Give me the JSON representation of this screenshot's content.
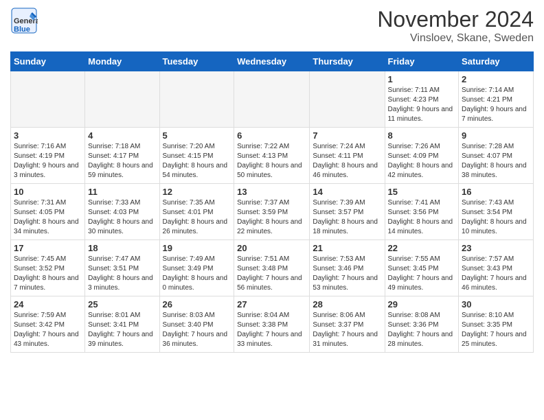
{
  "logo": {
    "line1": "General",
    "line2": "Blue"
  },
  "title": "November 2024",
  "location": "Vinsloev, Skane, Sweden",
  "days_of_week": [
    "Sunday",
    "Monday",
    "Tuesday",
    "Wednesday",
    "Thursday",
    "Friday",
    "Saturday"
  ],
  "weeks": [
    [
      {
        "day": "",
        "empty": true
      },
      {
        "day": "",
        "empty": true
      },
      {
        "day": "",
        "empty": true
      },
      {
        "day": "",
        "empty": true
      },
      {
        "day": "",
        "empty": true
      },
      {
        "day": "1",
        "sunrise": "7:11 AM",
        "sunset": "4:23 PM",
        "daylight": "9 hours and 11 minutes."
      },
      {
        "day": "2",
        "sunrise": "7:14 AM",
        "sunset": "4:21 PM",
        "daylight": "9 hours and 7 minutes."
      }
    ],
    [
      {
        "day": "3",
        "sunrise": "7:16 AM",
        "sunset": "4:19 PM",
        "daylight": "9 hours and 3 minutes."
      },
      {
        "day": "4",
        "sunrise": "7:18 AM",
        "sunset": "4:17 PM",
        "daylight": "8 hours and 59 minutes."
      },
      {
        "day": "5",
        "sunrise": "7:20 AM",
        "sunset": "4:15 PM",
        "daylight": "8 hours and 54 minutes."
      },
      {
        "day": "6",
        "sunrise": "7:22 AM",
        "sunset": "4:13 PM",
        "daylight": "8 hours and 50 minutes."
      },
      {
        "day": "7",
        "sunrise": "7:24 AM",
        "sunset": "4:11 PM",
        "daylight": "8 hours and 46 minutes."
      },
      {
        "day": "8",
        "sunrise": "7:26 AM",
        "sunset": "4:09 PM",
        "daylight": "8 hours and 42 minutes."
      },
      {
        "day": "9",
        "sunrise": "7:28 AM",
        "sunset": "4:07 PM",
        "daylight": "8 hours and 38 minutes."
      }
    ],
    [
      {
        "day": "10",
        "sunrise": "7:31 AM",
        "sunset": "4:05 PM",
        "daylight": "8 hours and 34 minutes."
      },
      {
        "day": "11",
        "sunrise": "7:33 AM",
        "sunset": "4:03 PM",
        "daylight": "8 hours and 30 minutes."
      },
      {
        "day": "12",
        "sunrise": "7:35 AM",
        "sunset": "4:01 PM",
        "daylight": "8 hours and 26 minutes."
      },
      {
        "day": "13",
        "sunrise": "7:37 AM",
        "sunset": "3:59 PM",
        "daylight": "8 hours and 22 minutes."
      },
      {
        "day": "14",
        "sunrise": "7:39 AM",
        "sunset": "3:57 PM",
        "daylight": "8 hours and 18 minutes."
      },
      {
        "day": "15",
        "sunrise": "7:41 AM",
        "sunset": "3:56 PM",
        "daylight": "8 hours and 14 minutes."
      },
      {
        "day": "16",
        "sunrise": "7:43 AM",
        "sunset": "3:54 PM",
        "daylight": "8 hours and 10 minutes."
      }
    ],
    [
      {
        "day": "17",
        "sunrise": "7:45 AM",
        "sunset": "3:52 PM",
        "daylight": "8 hours and 7 minutes."
      },
      {
        "day": "18",
        "sunrise": "7:47 AM",
        "sunset": "3:51 PM",
        "daylight": "8 hours and 3 minutes."
      },
      {
        "day": "19",
        "sunrise": "7:49 AM",
        "sunset": "3:49 PM",
        "daylight": "8 hours and 0 minutes."
      },
      {
        "day": "20",
        "sunrise": "7:51 AM",
        "sunset": "3:48 PM",
        "daylight": "7 hours and 56 minutes."
      },
      {
        "day": "21",
        "sunrise": "7:53 AM",
        "sunset": "3:46 PM",
        "daylight": "7 hours and 53 minutes."
      },
      {
        "day": "22",
        "sunrise": "7:55 AM",
        "sunset": "3:45 PM",
        "daylight": "7 hours and 49 minutes."
      },
      {
        "day": "23",
        "sunrise": "7:57 AM",
        "sunset": "3:43 PM",
        "daylight": "7 hours and 46 minutes."
      }
    ],
    [
      {
        "day": "24",
        "sunrise": "7:59 AM",
        "sunset": "3:42 PM",
        "daylight": "7 hours and 43 minutes."
      },
      {
        "day": "25",
        "sunrise": "8:01 AM",
        "sunset": "3:41 PM",
        "daylight": "7 hours and 39 minutes."
      },
      {
        "day": "26",
        "sunrise": "8:03 AM",
        "sunset": "3:40 PM",
        "daylight": "7 hours and 36 minutes."
      },
      {
        "day": "27",
        "sunrise": "8:04 AM",
        "sunset": "3:38 PM",
        "daylight": "7 hours and 33 minutes."
      },
      {
        "day": "28",
        "sunrise": "8:06 AM",
        "sunset": "3:37 PM",
        "daylight": "7 hours and 31 minutes."
      },
      {
        "day": "29",
        "sunrise": "8:08 AM",
        "sunset": "3:36 PM",
        "daylight": "7 hours and 28 minutes."
      },
      {
        "day": "30",
        "sunrise": "8:10 AM",
        "sunset": "3:35 PM",
        "daylight": "7 hours and 25 minutes."
      }
    ]
  ],
  "labels": {
    "sunrise": "Sunrise:",
    "sunset": "Sunset:",
    "daylight": "Daylight:"
  }
}
